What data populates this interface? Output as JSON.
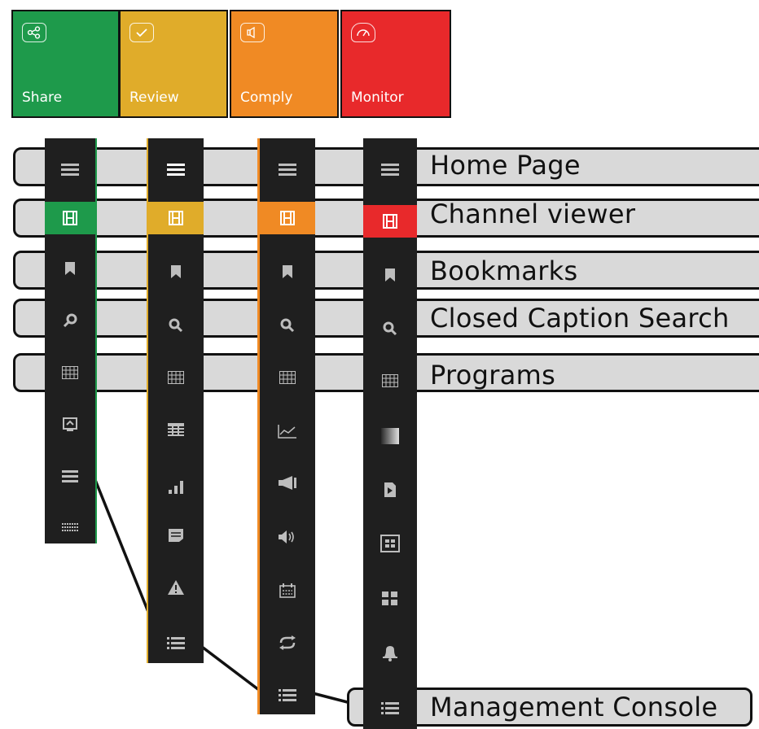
{
  "tiles": [
    {
      "label": "Share",
      "color": "#1e9a4b",
      "icon": "share-icon"
    },
    {
      "label": "Review",
      "color": "#e0ac2a",
      "icon": "check-icon"
    },
    {
      "label": "Comply",
      "color": "#f08a24",
      "icon": "speaker-icon"
    },
    {
      "label": "Monitor",
      "color": "#e8292b",
      "icon": "gauge-icon"
    }
  ],
  "callouts": {
    "home": "Home Page",
    "channel": "Channel viewer",
    "bookmarks": "Bookmarks",
    "cc_search": "Closed Caption Search",
    "programs": "Programs",
    "management": "Management Console"
  },
  "sidebars": {
    "share": [
      "menu-icon",
      "film-icon",
      "bookmark-icon",
      "search-icon",
      "grid-icon",
      "screen-icon",
      "list-icon",
      "dots-icon"
    ],
    "review": [
      "menu-icon",
      "film-icon",
      "bookmark-icon",
      "search-icon",
      "grid-icon",
      "table-icon",
      "bars-icon",
      "note-icon",
      "warning-icon",
      "list-icon"
    ],
    "comply": [
      "menu-icon",
      "film-icon",
      "bookmark-icon",
      "search-icon",
      "grid-icon",
      "linechart-icon",
      "megaphone-icon",
      "volume-icon",
      "calendar-icon",
      "repeat-icon",
      "list-icon"
    ],
    "monitor": [
      "menu-icon",
      "film-icon",
      "bookmark-icon",
      "search-icon",
      "grid-icon",
      "gradient-icon",
      "play-doc-icon",
      "dashboard-icon",
      "tiles-icon",
      "bell-icon",
      "list-icon"
    ]
  },
  "colors": {
    "bar": "#1f1f1f",
    "icon": "#bdbdbd",
    "icon_active": "#ffffff"
  }
}
